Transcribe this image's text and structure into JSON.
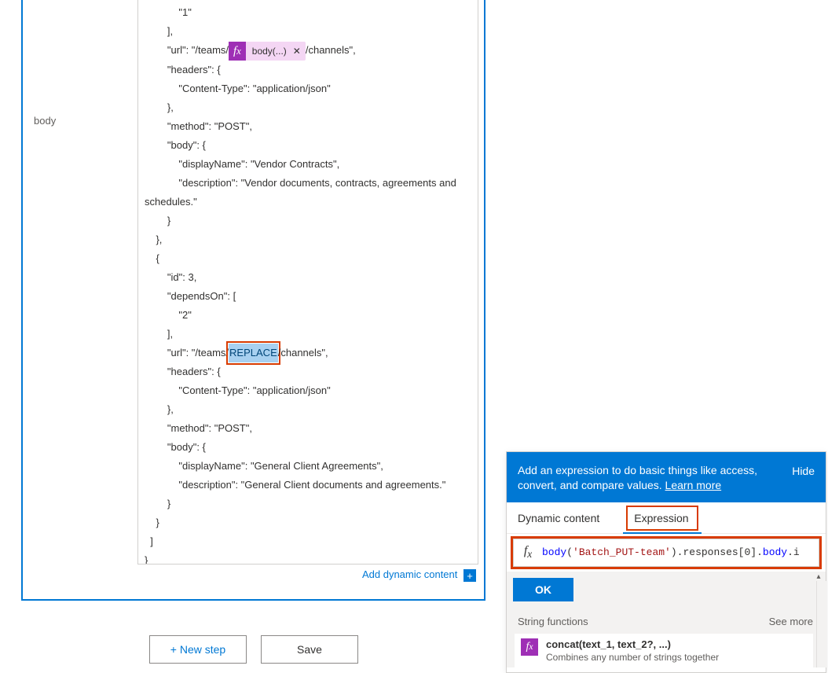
{
  "card": {
    "body_label": "body",
    "code_lines": [
      "            \"1\"",
      "        ],",
      "        \"url\": \"/teams/{{TOKEN}}/channels\",",
      "        \"headers\": {",
      "            \"Content-Type\": \"application/json\"",
      "        },",
      "        \"method\": \"POST\",",
      "        \"body\": {",
      "            \"displayName\": \"Vendor Contracts\",",
      "            \"description\": \"Vendor documents, contracts, agreements and schedules.\"",
      "        }",
      "    },",
      "    {",
      "        \"id\": 3,",
      "        \"dependsOn\": [",
      "            \"2\"",
      "        ],",
      "        \"url\": \"/teams/{{REPLACE}}/channels\",",
      "        \"headers\": {",
      "            \"Content-Type\": \"application/json\"",
      "        },",
      "        \"method\": \"POST\",",
      "        \"body\": {",
      "            \"displayName\": \"General Client Agreements\",",
      "            \"description\": \"General Client documents and agreements.\"",
      "        }",
      "    }",
      "  ]",
      "}"
    ],
    "token_label": "body(...)",
    "replace_label": "REPLACE",
    "add_dynamic_label": "Add dynamic content"
  },
  "buttons": {
    "new_step": "+ New step",
    "save": "Save"
  },
  "panel": {
    "intro": "Add an expression to do basic things like access, convert, and compare values. ",
    "learn_more": "Learn more",
    "hide": "Hide",
    "tab_dynamic": "Dynamic content",
    "tab_expression": "Expression",
    "formula_kw": "body",
    "formula_paren_open": "(",
    "formula_str": "'Batch_PUT-team'",
    "formula_rest": ").responses[0].",
    "formula_kw2": "body",
    "formula_tail": ".i",
    "ok": "OK",
    "func_heading": "String functions",
    "see_more": "See more",
    "func_title": "concat(text_1, text_2?, ...)",
    "func_desc": "Combines any number of strings together"
  }
}
